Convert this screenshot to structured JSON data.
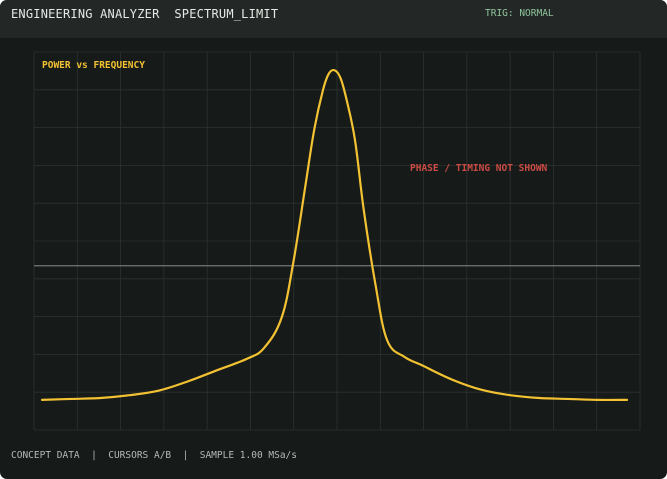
{
  "header": {
    "title": "ENGINEERING ANALYZER  SPECTRUM_LIMIT",
    "trigger": "TRIG: NORMAL"
  },
  "plot": {
    "label": "POWER vs FREQUENCY",
    "annotation": "PHASE / TIMING NOT SHOWN",
    "colors": {
      "trace": "#f2c232",
      "label": "#f2c232",
      "annotation": "#cc4b44",
      "grid": "#2c3331",
      "reference": "#707775",
      "background": "#161a19"
    }
  },
  "footer": {
    "status": "CONCEPT DATA  |  CURSORS A/B  |  SAMPLE 1.00 MSa/s"
  },
  "chart_data": {
    "type": "line",
    "x": [
      0.0,
      0.05,
      0.1,
      0.15,
      0.2,
      0.25,
      0.3,
      0.35,
      0.38,
      0.41,
      0.43,
      0.45,
      0.465,
      0.48,
      0.49,
      0.5,
      0.51,
      0.52,
      0.535,
      0.55,
      0.57,
      0.59,
      0.62,
      0.65,
      0.7,
      0.75,
      0.8,
      0.85,
      0.9,
      0.95,
      1.0
    ],
    "values": [
      0.06,
      0.07,
      0.08,
      0.11,
      0.16,
      0.26,
      0.38,
      0.5,
      0.62,
      0.95,
      1.55,
      2.35,
      2.95,
      3.38,
      3.56,
      3.6,
      3.52,
      3.3,
      2.85,
      2.1,
      1.3,
      0.7,
      0.52,
      0.43,
      0.28,
      0.17,
      0.11,
      0.08,
      0.07,
      0.06,
      0.06
    ],
    "xlim": [
      0,
      1
    ],
    "ylim": [
      -0.5,
      4.0
    ],
    "reference_line": 1.5,
    "grid": true
  }
}
